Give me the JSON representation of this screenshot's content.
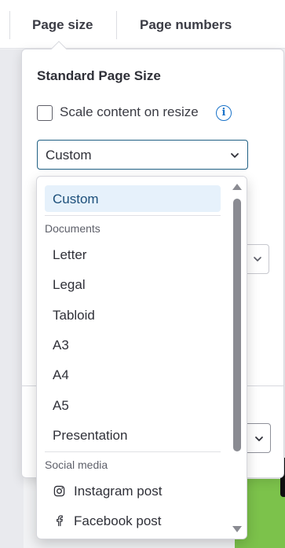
{
  "tabs": [
    {
      "label": "Page size"
    },
    {
      "label": "Page numbers"
    }
  ],
  "panel": {
    "title": "Standard Page Size",
    "scale_checkbox_label": "Scale content on resize",
    "scale_checked": false,
    "select_value": "Custom"
  },
  "dropdown": {
    "selected": "Custom",
    "groups": [
      {
        "label": "Documents",
        "items": [
          "Letter",
          "Legal",
          "Tabloid",
          "A3",
          "A4",
          "A5",
          "Presentation"
        ]
      },
      {
        "label": "Social media",
        "items": [
          "Instagram post",
          "Facebook post"
        ]
      }
    ],
    "icons": {
      "instagram": "instagram-icon",
      "facebook": "facebook-icon"
    }
  },
  "colors": {
    "accent": "#1a73c9",
    "select_border": "#1f5f83",
    "selected_bg": "#e6f1fb",
    "canvas_green": "#7cc24b"
  }
}
